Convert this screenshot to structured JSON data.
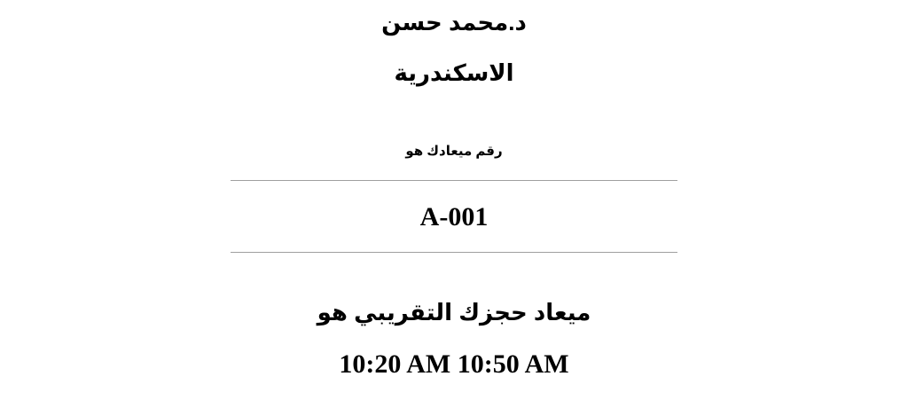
{
  "header": {
    "doctor_name": "د.محمد حسن",
    "city": "الاسكندرية"
  },
  "appointment": {
    "number_label": "رقم ميعادك هو",
    "number": "A-001",
    "time_label": "ميعاد حجزك التقريبي هو",
    "time_range": "10:20 AM 10:50 AM"
  }
}
